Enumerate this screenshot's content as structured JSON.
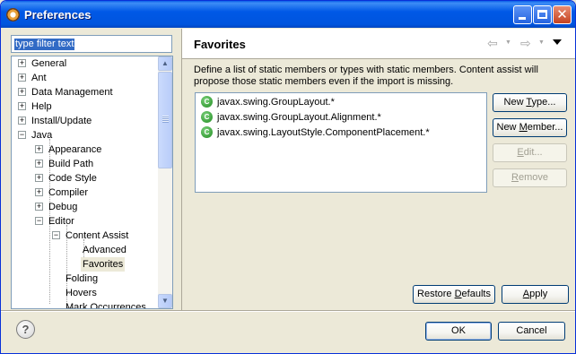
{
  "window": {
    "title": "Preferences"
  },
  "filter": {
    "value": "type filter text"
  },
  "tree": {
    "items": [
      {
        "label": "General",
        "expander": "+"
      },
      {
        "label": "Ant",
        "expander": "+"
      },
      {
        "label": "Data Management",
        "expander": "+"
      },
      {
        "label": "Help",
        "expander": "+"
      },
      {
        "label": "Install/Update",
        "expander": "+"
      },
      {
        "label": "Java",
        "expander": "−"
      },
      {
        "label": "Appearance",
        "expander": "+"
      },
      {
        "label": "Build Path",
        "expander": "+"
      },
      {
        "label": "Code Style",
        "expander": "+"
      },
      {
        "label": "Compiler",
        "expander": "+"
      },
      {
        "label": "Debug",
        "expander": "+"
      },
      {
        "label": "Editor",
        "expander": "−"
      },
      {
        "label": "Content Assist",
        "expander": "−"
      },
      {
        "label": "Advanced",
        "expander": ""
      },
      {
        "label": "Favorites",
        "expander": "",
        "selected": true
      },
      {
        "label": "Folding",
        "expander": ""
      },
      {
        "label": "Hovers",
        "expander": ""
      },
      {
        "label": "Mark Occurrences",
        "expander": ""
      }
    ]
  },
  "page": {
    "title": "Favorites",
    "description": "Define a list of static members or types with static members. Content assist will propose those static members even if the import is missing."
  },
  "favorites": [
    "javax.swing.GroupLayout.*",
    "javax.swing.GroupLayout.Alignment.*",
    "javax.swing.LayoutStyle.ComponentPlacement.*"
  ],
  "buttons": {
    "new_type": {
      "pre": "New ",
      "u": "T",
      "post": "ype..."
    },
    "new_member": {
      "pre": "New ",
      "u": "M",
      "post": "ember..."
    },
    "edit": {
      "pre": "",
      "u": "E",
      "post": "dit..."
    },
    "remove": {
      "pre": "",
      "u": "R",
      "post": "emove"
    },
    "restore_defaults": {
      "pre": "Restore ",
      "u": "D",
      "post": "efaults"
    },
    "apply": {
      "pre": "",
      "u": "A",
      "post": "pply"
    },
    "ok": "OK",
    "cancel": "Cancel"
  },
  "icons": {
    "app": "eclipse-icon",
    "help": "help-icon",
    "back": "back-arrow-icon",
    "forward": "forward-arrow-icon",
    "class": "class-icon"
  },
  "colors": {
    "titlebar": "#0058E6",
    "selection": "#316AC5",
    "class_icon": "#1E8A1E"
  }
}
